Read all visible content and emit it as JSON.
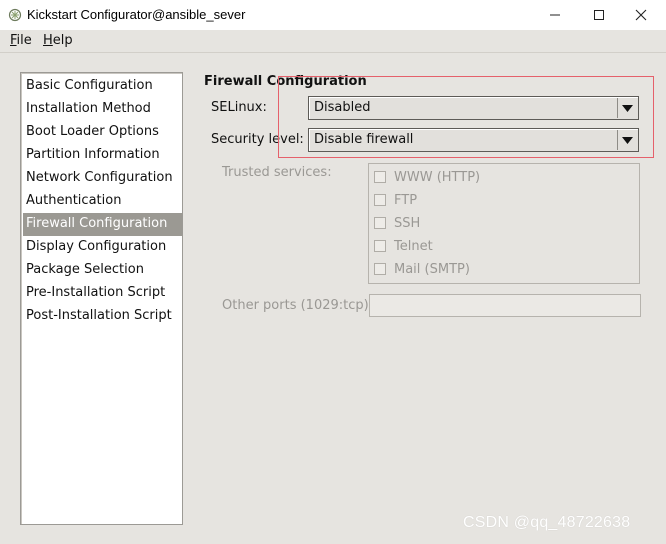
{
  "window": {
    "title": "Kickstart Configurator@ansible_sever",
    "icon": "kickstart-app-icon",
    "controls": [
      "minimize-icon",
      "maximize-icon",
      "close-icon"
    ]
  },
  "menu": {
    "file_prefix": "F",
    "file_rest": "ile",
    "help_prefix": "H",
    "help_rest": "elp"
  },
  "sidebar": {
    "items": [
      {
        "label": "Basic Configuration"
      },
      {
        "label": "Installation Method"
      },
      {
        "label": "Boot Loader Options"
      },
      {
        "label": "Partition Information"
      },
      {
        "label": "Network Configuration"
      },
      {
        "label": "Authentication"
      },
      {
        "label": "Firewall Configuration",
        "selected": true
      },
      {
        "label": "Display Configuration"
      },
      {
        "label": "Package Selection"
      },
      {
        "label": "Pre-Installation Script"
      },
      {
        "label": "Post-Installation Script"
      }
    ]
  },
  "firewall": {
    "title": "Firewall Configuration",
    "selinux_label": "SELinux:",
    "selinux_value": "Disabled",
    "security_label": "Security level:",
    "security_value": "Disable firewall",
    "trusted_label": "Trusted services:",
    "services": [
      {
        "label": "WWW (HTTP)",
        "checked": false
      },
      {
        "label": "FTP",
        "checked": false
      },
      {
        "label": "SSH",
        "checked": false
      },
      {
        "label": "Telnet",
        "checked": false
      },
      {
        "label": "Mail (SMTP)",
        "checked": false
      }
    ],
    "other_ports_label": "Other ports (1029:tcp):",
    "other_ports_value": ""
  },
  "colors": {
    "selected_bg": "#9b9993",
    "highlight_border": "#e5606b",
    "panel_bg": "#e6e4e0"
  },
  "watermark": "CSDN @qq_48722638"
}
